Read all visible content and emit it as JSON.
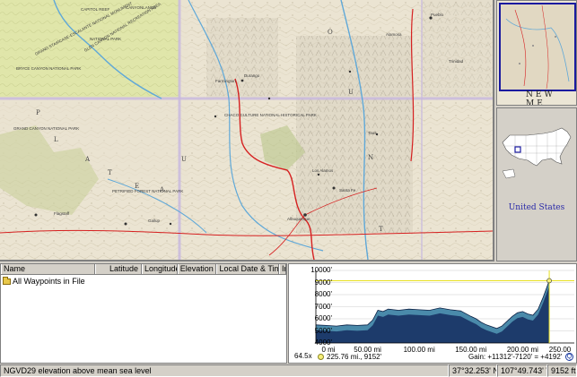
{
  "map": {
    "labels": [
      {
        "text": "CAPITOL REEF"
      },
      {
        "text": "CANYONLANDS"
      },
      {
        "text": "NATIONAL PARK"
      },
      {
        "text": "GRAND STAIRCASE-ESCALANTE NATIONAL MONUMENT"
      },
      {
        "text": "GLEN CANYON NATIONAL RECREATION AREA"
      },
      {
        "text": "BRYCE CANYON NATIONAL PARK"
      },
      {
        "text": "Pueblo"
      },
      {
        "text": "GRAND CANYON NATIONAL PARK"
      },
      {
        "text": "Flagstaff"
      },
      {
        "text": "Santa Fe"
      },
      {
        "text": "Albuquerque"
      },
      {
        "text": "Los Alamos"
      },
      {
        "text": "Durango"
      },
      {
        "text": "Gallup"
      },
      {
        "text": "CHACO CULTURE NATIONAL HISTORICAL PARK"
      },
      {
        "text": "PETRIFIED FOREST NATIONAL PARK"
      },
      {
        "text": "Farmington"
      },
      {
        "text": "Taos"
      },
      {
        "text": "Alamosa"
      },
      {
        "text": "Trinidad"
      }
    ],
    "big_letters": [
      "O",
      "U",
      "N",
      "T"
    ],
    "state_letters": [
      "P",
      "L",
      "A",
      "T",
      "E",
      "A",
      "U"
    ]
  },
  "overview": {
    "label": "NEW ME"
  },
  "usmap": {
    "caption": "United States"
  },
  "waypoints": {
    "columns": [
      "Name",
      "Latitude",
      "Longitude",
      "Elevation",
      "Local Date & Time",
      "In F"
    ],
    "items": [
      {
        "label": "All Waypoints in File"
      }
    ]
  },
  "profile": {
    "y_ticks": [
      "10000'",
      "9000'",
      "8000'",
      "7000'",
      "6000'",
      "5000'",
      "4000'"
    ],
    "x_ticks": [
      "0 mi",
      "50.00 mi",
      "100.00 mi",
      "150.00 mi",
      "200.00 mi",
      "250.00"
    ],
    "zoom": "64.5x",
    "cursor_text": "225.76 mi., 9152'",
    "gain_text": "Gain: +11312'-7120' = +4192'",
    "zoom_icon_label": "Q"
  },
  "chart_data": {
    "type": "area",
    "title": "",
    "xlabel": "",
    "ylabel": "",
    "xlim": [
      0,
      250
    ],
    "ylim": [
      4000,
      10000
    ],
    "x": [
      0,
      10,
      20,
      30,
      40,
      50,
      55,
      60,
      65,
      70,
      80,
      90,
      100,
      110,
      120,
      130,
      140,
      150,
      155,
      160,
      165,
      170,
      175,
      180,
      185,
      190,
      195,
      200,
      205,
      210,
      215,
      220,
      225.76
    ],
    "y": [
      5500,
      5450,
      5400,
      5500,
      5450,
      5500,
      5900,
      6700,
      6600,
      6800,
      6700,
      6800,
      6750,
      6700,
      6900,
      6750,
      6650,
      6200,
      6000,
      5700,
      5500,
      5350,
      5200,
      5400,
      5800,
      6200,
      6500,
      6600,
      6400,
      6300,
      6800,
      7800,
      9152
    ],
    "cursor": {
      "x": 225.76,
      "y": 9152
    },
    "colors": {
      "fill_dark": "#1d3b6b",
      "fill_light": "#4a8aaa",
      "cursor_line": "#e8e020"
    }
  },
  "status": {
    "datum": "NGVD29 elevation above mean sea level",
    "latitude": "37°32.253' N",
    "longitude": "107°49.743' W",
    "elevation": "9152 ft."
  }
}
